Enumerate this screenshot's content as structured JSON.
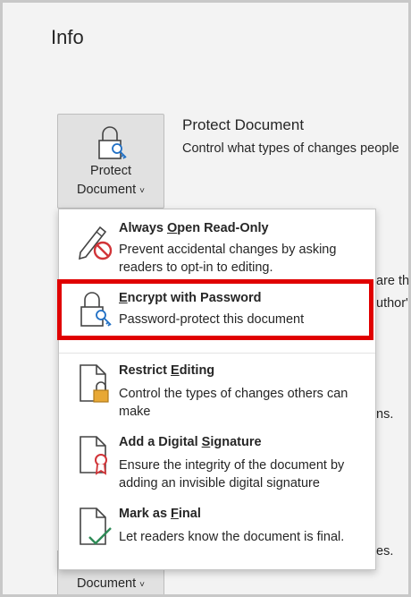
{
  "page": {
    "title": "Info"
  },
  "protect": {
    "button_line1": "Protect",
    "button_line2": "Document",
    "chevron": "˅",
    "section_title": "Protect Document",
    "section_desc": "Control what types of changes people"
  },
  "background_fragments": {
    "frag1": "are th",
    "frag2": "uthor's",
    "frag3": "ns.",
    "frag4": "es."
  },
  "manage": {
    "label": "Document"
  },
  "menu": {
    "items": [
      {
        "title_pre": "Always ",
        "title_key": "O",
        "title_post": "pen Read-Only",
        "desc": "Prevent accidental changes by asking readers to opt-in to editing.",
        "icon": "pencil-no-icon"
      },
      {
        "title_pre": "",
        "title_key": "E",
        "title_post": "ncrypt with Password",
        "desc": "Password-protect this document",
        "icon": "lock-key-icon"
      },
      {
        "title_pre": "Restrict ",
        "title_key": "E",
        "title_post": "diting",
        "desc": "Control the types of changes others can make",
        "icon": "document-lock-icon"
      },
      {
        "title_pre": "Add a Digital ",
        "title_key": "S",
        "title_post": "ignature",
        "desc": "Ensure the integrity of the document by adding an invisible digital signature",
        "icon": "document-ribbon-icon"
      },
      {
        "title_pre": "Mark as ",
        "title_key": "F",
        "title_post": "inal",
        "desc": "Let readers know the document is final.",
        "icon": "document-check-icon"
      }
    ]
  },
  "colors": {
    "highlight": "#e00000",
    "lock_accent": "#1f6fc4",
    "badge": "#d13438",
    "lock_gold": "#e8a835",
    "check": "#2e8b57"
  }
}
